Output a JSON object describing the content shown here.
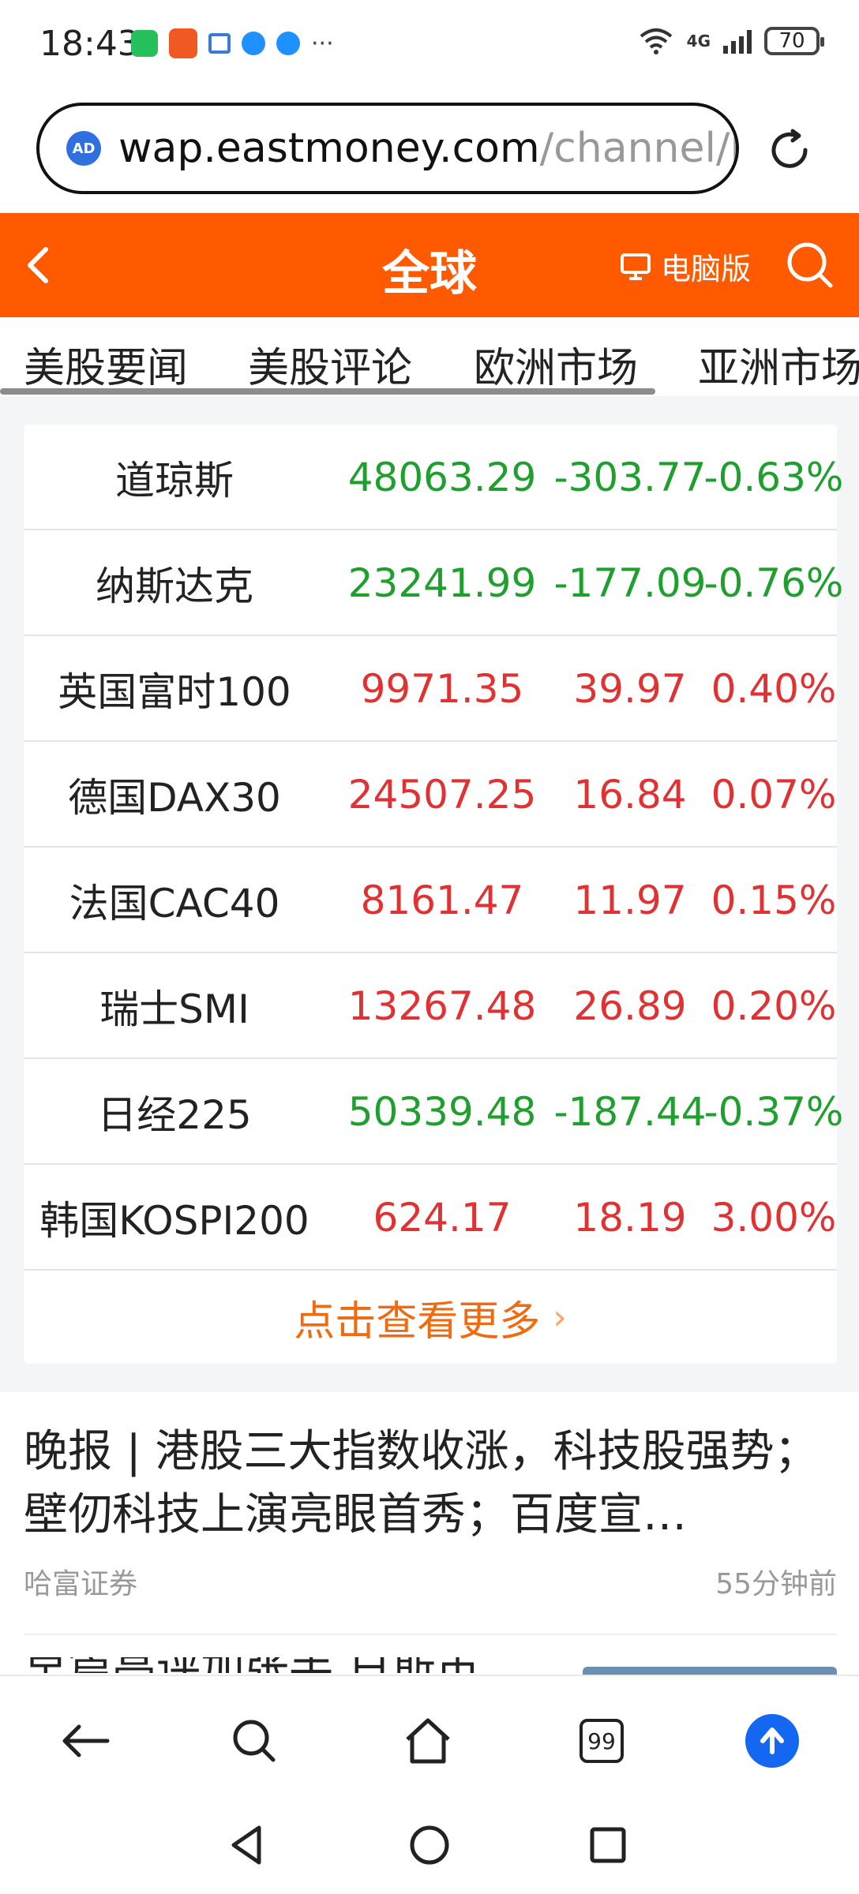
{
  "status_bar": {
    "time": "18:43",
    "network_label": "4G",
    "wifi_label": "6",
    "battery": "70",
    "overflow_dots": "···"
  },
  "browser": {
    "ad_badge": "AD",
    "url_host": "wap.eastmoney.com",
    "url_path": "/channel/lis"
  },
  "header": {
    "title": "全球",
    "pc_version": "电脑版"
  },
  "tabs": [
    "美股要闻",
    "美股评论",
    "欧洲市场",
    "亚洲市场"
  ],
  "market": {
    "rows": [
      {
        "name": "道琼斯",
        "price": "48063.29",
        "change": "-303.77",
        "percent": "-0.63%",
        "dir": "down"
      },
      {
        "name": "纳斯达克",
        "price": "23241.99",
        "change": "-177.09",
        "percent": "-0.76%",
        "dir": "down"
      },
      {
        "name": "英国富时100",
        "price": "9971.35",
        "change": "39.97",
        "percent": "0.40%",
        "dir": "up"
      },
      {
        "name": "德国DAX30",
        "price": "24507.25",
        "change": "16.84",
        "percent": "0.07%",
        "dir": "up"
      },
      {
        "name": "法国CAC40",
        "price": "8161.47",
        "change": "11.97",
        "percent": "0.15%",
        "dir": "up"
      },
      {
        "name": "瑞士SMI",
        "price": "13267.48",
        "change": "26.89",
        "percent": "0.20%",
        "dir": "up"
      },
      {
        "name": "日经225",
        "price": "50339.48",
        "change": "-187.44",
        "percent": "-0.37%",
        "dir": "down"
      },
      {
        "name": "韩国KOSPI200",
        "price": "624.17",
        "change": "18.19",
        "percent": "3.00%",
        "dir": "up"
      }
    ],
    "more_label": "点击查看更多"
  },
  "news": [
    {
      "title": "晚报 | 港股三大指数收涨，科技股强势；壁仞科技上演亮眼首秀；百度宣…",
      "source": "哈富证券",
      "time": "55分钟前"
    }
  ],
  "news_peek": "早篇亮评加张手 日斯市",
  "bottom_bar": {
    "tab_count": "99"
  },
  "colors": {
    "brand_orange": "#ff5a00",
    "up_red": "#e03232",
    "down_green": "#1e9f2e",
    "more_orange": "#f06a10",
    "accent_blue": "#1467f0"
  }
}
